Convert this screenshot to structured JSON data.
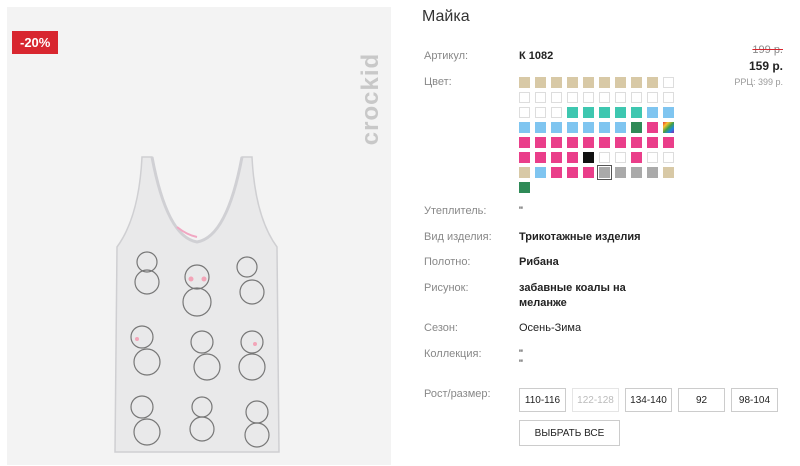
{
  "badge": {
    "discount": "-20%"
  },
  "brand": {
    "name": "crockid"
  },
  "product": {
    "title": "Майка",
    "article_label": "Артикул:",
    "article": "К 1082",
    "old_price": "199 р.",
    "price": "159 р.",
    "rrp": "РРЦ: 399 р.",
    "color_label": "Цвет:",
    "insulation_label": "Утеплитель:",
    "insulation": "\"",
    "type_label": "Вид изделия:",
    "type": "Трикотажные изделия",
    "fabric_label": "Полотно:",
    "fabric": "Рибана",
    "pattern_label": "Рисунок:",
    "pattern_line1": "забавные коалы на",
    "pattern_line2": "меланже",
    "season_label": "Сезон:",
    "season": "Осень-Зима",
    "collection_label": "Коллекция:",
    "collection_line1": "\"",
    "collection_line2": "\"",
    "size_label": "Рост/размер:"
  },
  "swatch_rows": [
    [
      "#d8c9a6",
      "#d8c9a6",
      "#d8c9a6",
      "#d8c9a6",
      "#d8c9a6",
      "#d8c9a6",
      "#d8c9a6",
      "#d8c9a6",
      "#d8c9a6",
      "#ffffff"
    ],
    [
      "#ffffff",
      "#ffffff",
      "#ffffff",
      "#ffffff",
      "#ffffff",
      "#ffffff",
      "#ffffff",
      "#ffffff",
      "#ffffff",
      "#ffffff"
    ],
    [
      "#ffffff",
      "#ffffff",
      "#ffffff",
      "#3ec7b0",
      "#3ec7b0",
      "#3ec7b0",
      "#3ec7b0",
      "#3ec7b0",
      "#7fc5f0",
      "#7fc5f0"
    ],
    [
      "#7fc5f0",
      "#7fc5f0",
      "#7fc5f0",
      "#7fc5f0",
      "#7fc5f0",
      "#7fc5f0",
      "#7fc5f0",
      "#2f8a57",
      "#ea3e8a",
      "rainbow"
    ],
    [
      "#ea3e8a",
      "#ea3e8a",
      "#ea3e8a",
      "#ea3e8a",
      "#ea3e8a",
      "#ea3e8a",
      "#ea3e8a",
      "#ea3e8a",
      "#ea3e8a",
      "#ea3e8a"
    ],
    [
      "#ea3e8a",
      "#ea3e8a",
      "#ea3e8a",
      "#ea3e8a",
      "#111111",
      "#ffffff",
      "#ffffff",
      "#ea3e8a",
      "#ffffff",
      "#ffffff"
    ],
    [
      "#d8c9a6",
      "#7fc5f0",
      "#ea3e8a",
      "#ea3e8a",
      "#ea3e8a",
      "#aaaaaa",
      "#aaaaaa",
      "#aaaaaa",
      "#aaaaaa",
      "#d8c9a6"
    ],
    [
      "#2f8a57"
    ]
  ],
  "selected_swatch": "6-5",
  "sizes": [
    {
      "label": "110-116",
      "disabled": false
    },
    {
      "label": "122-128",
      "disabled": true
    },
    {
      "label": "134-140",
      "disabled": false
    },
    {
      "label": "92",
      "disabled": false
    },
    {
      "label": "98-104",
      "disabled": false
    }
  ],
  "select_all_label": "ВЫБРАТЬ ВСЕ"
}
